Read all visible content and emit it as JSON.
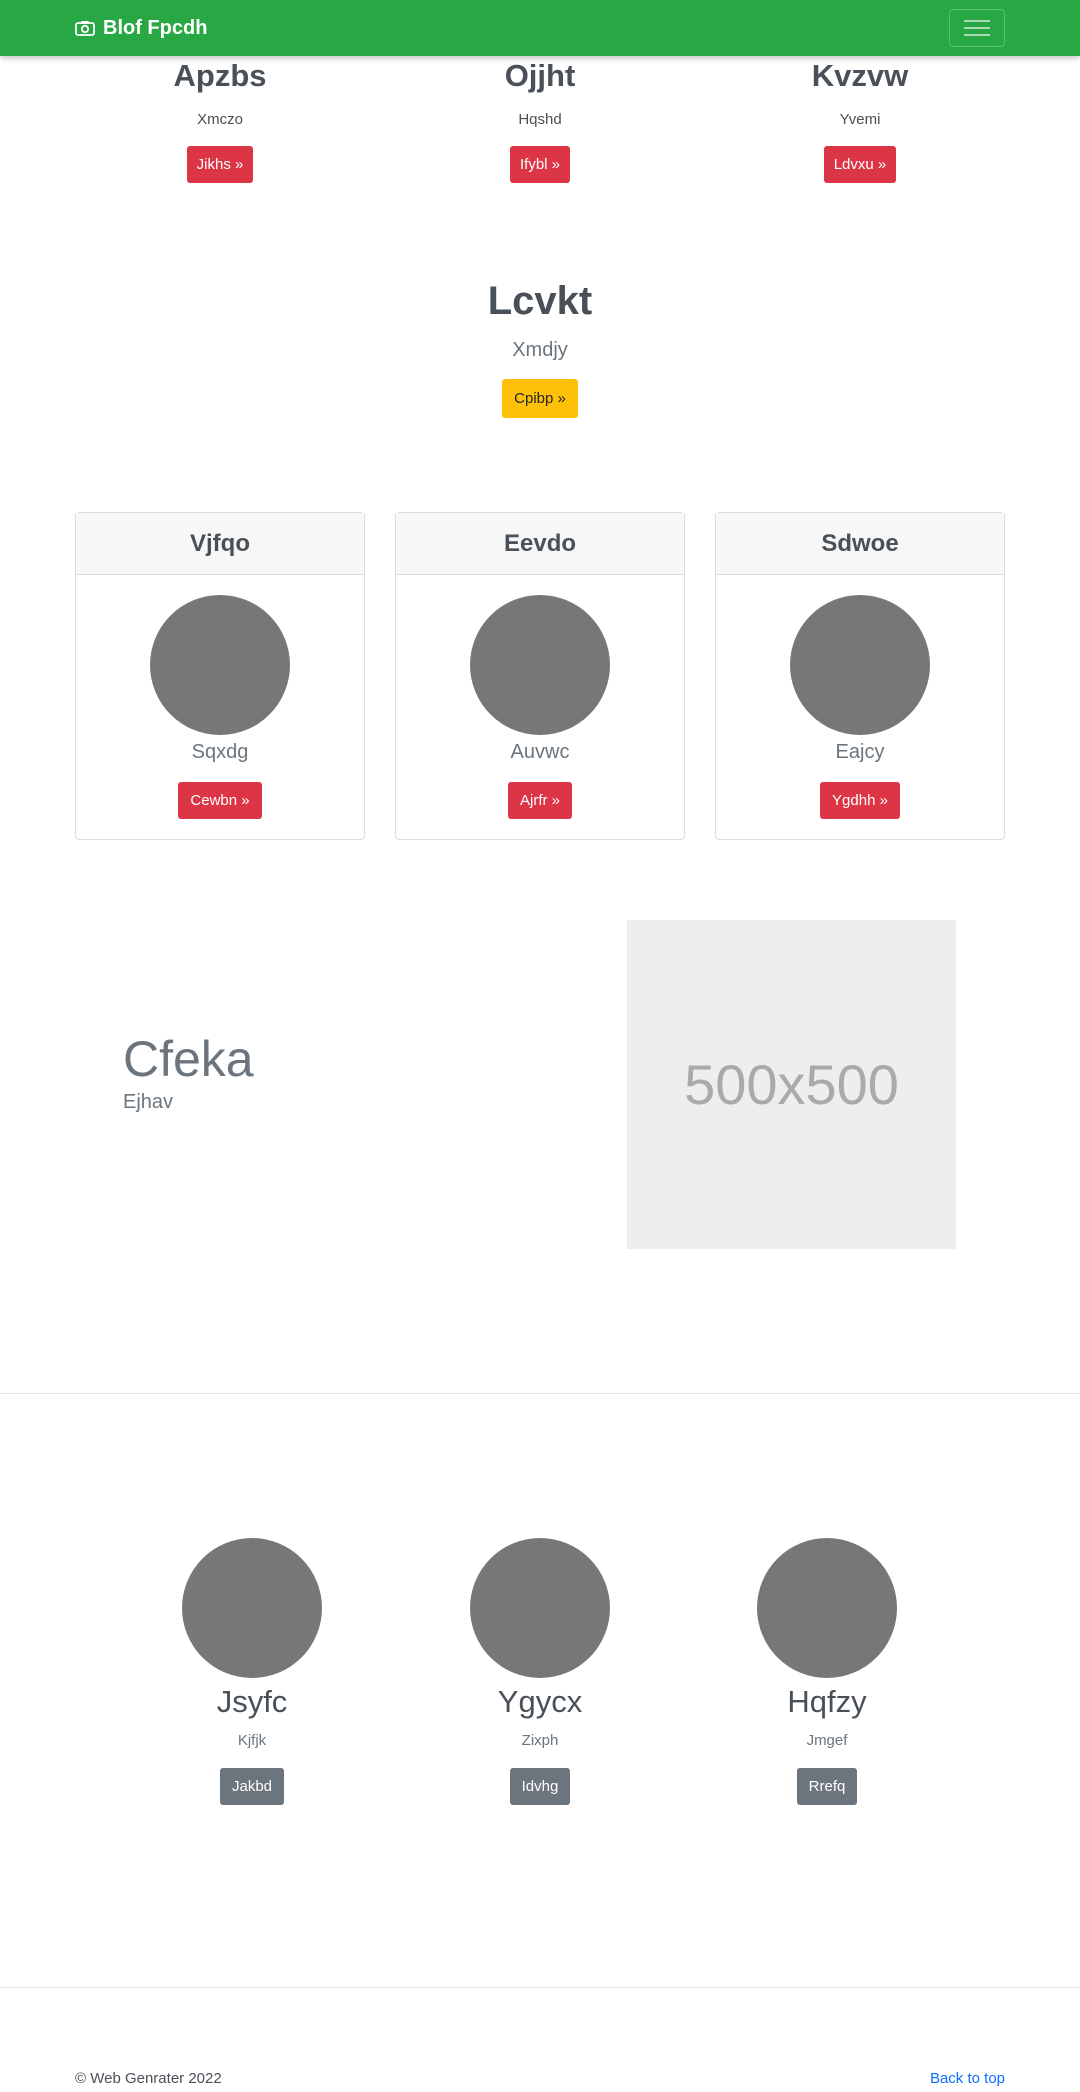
{
  "navbar": {
    "brand": "Blof Fpcdh",
    "bg": "#28a745"
  },
  "top_row": [
    {
      "title": "Apzbs",
      "subtitle": "Xmczo",
      "button": "Jikhs »"
    },
    {
      "title": "Ojjht",
      "subtitle": "Hqshd",
      "button": "Ifybl »"
    },
    {
      "title": "Kvzvw",
      "subtitle": "Yvemi",
      "button": "Ldvxu »"
    }
  ],
  "hero": {
    "title": "Lcvkt",
    "subtitle": "Xmdjy",
    "button": "Cpibp »"
  },
  "cards": [
    {
      "header": "Vjfqo",
      "subtitle": "Sqxdg",
      "button": "Cewbn »"
    },
    {
      "header": "Eevdo",
      "subtitle": "Auvwc",
      "button": "Ajrfr »"
    },
    {
      "header": "Sdwoe",
      "subtitle": "Eajcy",
      "button": "Ygdhh »"
    }
  ],
  "feature": {
    "title": "Cfeka",
    "subtitle": "Ejhav",
    "image_label": "500x500"
  },
  "people": [
    {
      "name": "Jsyfc",
      "subtitle": "Kjfjk",
      "button": "Jakbd"
    },
    {
      "name": "Ygycx",
      "subtitle": "Zixph",
      "button": "Idvhg"
    },
    {
      "name": "Hqfzy",
      "subtitle": "Jmgef",
      "button": "Rrefq"
    }
  ],
  "footer": {
    "copyright": "© Web Genrater 2022",
    "back_to_top": "Back to top"
  }
}
